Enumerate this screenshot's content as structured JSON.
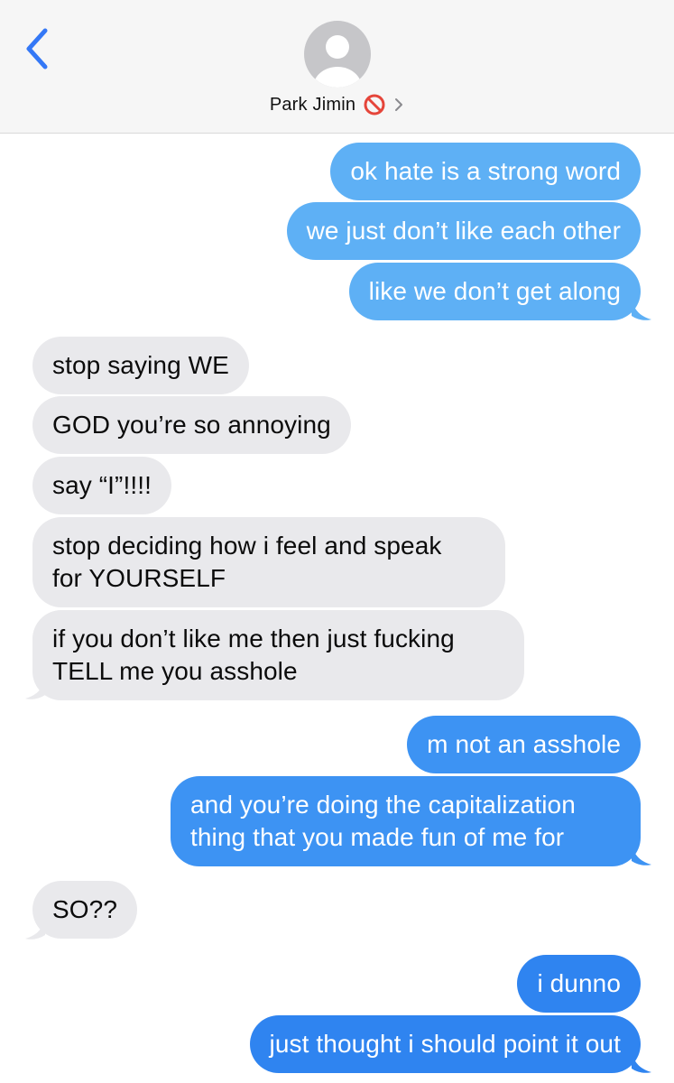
{
  "header": {
    "contact_name": "Park Jimin",
    "blocked_icon": "blocked-icon",
    "back_icon": "chevron-left-icon",
    "details_icon": "chevron-right-icon",
    "accent_color": "#3478f6"
  },
  "messages": [
    {
      "from": "me",
      "text": "ok hate is a strong word",
      "color": "#5eb0f5"
    },
    {
      "from": "me",
      "text": "we just don’t like each other",
      "color": "#5eb0f5"
    },
    {
      "from": "me",
      "text": "like we don’t get along",
      "color": "#5eb0f5"
    },
    {
      "from": "them",
      "text": "stop saying WE",
      "color": "#e9e9ec"
    },
    {
      "from": "them",
      "text": "GOD you’re so annoying",
      "color": "#e9e9ec"
    },
    {
      "from": "them",
      "text": "say “I”!!!!",
      "color": "#e9e9ec"
    },
    {
      "from": "them",
      "text": "stop deciding how i feel and speak\nfor YOURSELF",
      "color": "#e9e9ec"
    },
    {
      "from": "them",
      "text": "if you don’t like me then just fucking\nTELL me you asshole",
      "color": "#e9e9ec"
    },
    {
      "from": "me",
      "text": "m not an asshole",
      "color": "#3d93f3"
    },
    {
      "from": "me",
      "text": "and you’re doing the capitalization\nthing that you made fun of me for",
      "color": "#3d93f3"
    },
    {
      "from": "them",
      "text": "SO??",
      "color": "#e9e9ec"
    },
    {
      "from": "me",
      "text": "i dunno",
      "color": "#2f84f0"
    },
    {
      "from": "me",
      "text": "just thought i should point it out",
      "color": "#2f84f0"
    }
  ]
}
